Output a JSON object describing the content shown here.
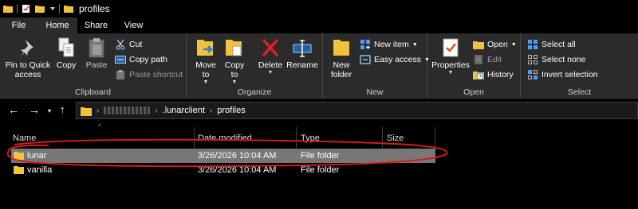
{
  "window": {
    "title": "profiles"
  },
  "ribbon_tabs": [
    "File",
    "Home",
    "Share",
    "View"
  ],
  "clipboard": {
    "pin_label": "Pin to Quick access",
    "copy_label": "Copy",
    "paste_label": "Paste",
    "cut_label": "Cut",
    "copy_path_label": "Copy path",
    "paste_shortcut_label": "Paste shortcut",
    "group_label": "Clipboard"
  },
  "organize": {
    "move_to_label": "Move to",
    "copy_to_label": "Copy to",
    "delete_label": "Delete",
    "rename_label": "Rename",
    "group_label": "Organize"
  },
  "new": {
    "new_folder_label": "New folder",
    "new_item_label": "New item",
    "easy_access_label": "Easy access",
    "group_label": "New"
  },
  "open": {
    "properties_label": "Properties",
    "open_label": "Open",
    "edit_label": "Edit",
    "history_label": "History",
    "group_label": "Open"
  },
  "select": {
    "select_all_label": "Select all",
    "select_none_label": "Select none",
    "invert_selection_label": "Invert selection",
    "group_label": "Select"
  },
  "address": {
    "crumbs": [
      ".lunarclient",
      "profiles"
    ]
  },
  "columns": {
    "name": "Name",
    "date_modified": "Date modified",
    "type": "Type",
    "size": "Size"
  },
  "files": [
    {
      "name": "lunar",
      "date": "3/26/2026 10:04 AM",
      "type": "File folder",
      "selected": true
    },
    {
      "name": "vanilla",
      "date": "3/26/2026 10:04 AM",
      "type": "File folder",
      "selected": false
    }
  ],
  "colors": {
    "background": "#000000",
    "ribbon": "#2b2b2b",
    "selected_row": "#777777",
    "folder": "#f3c23c",
    "annotation": "#d41a1a"
  }
}
